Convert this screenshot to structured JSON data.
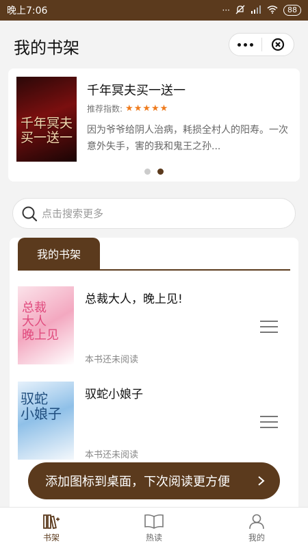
{
  "status_bar": {
    "time": "晚上7:06",
    "battery": "88"
  },
  "header": {
    "title": "我的书架"
  },
  "banner": {
    "title": "千年冥夫买一送一",
    "rating_label": "推荐指数:",
    "stars": "★★★★★",
    "description": "因为爷爷给阴人治病，耗损全村人的阳寿。一次意外失手，害的我和鬼王之孙...",
    "cover_text": "千年冥夫\n买一送一"
  },
  "search": {
    "placeholder": "点击搜索更多"
  },
  "shelf": {
    "tab_label": "我的书架",
    "books": [
      {
        "title": "总裁大人，晚上见!",
        "status": "本书还未阅读",
        "cover_text": "总裁\n大人\n晚上见"
      },
      {
        "title": "驭蛇小娘子",
        "status": "本书还未阅读",
        "cover_text": "驭蛇\n小娘子"
      }
    ]
  },
  "toast": {
    "text": "添加图标到桌面，下次阅读更方便"
  },
  "tabbar": {
    "items": [
      {
        "label": "书架"
      },
      {
        "label": "热读"
      },
      {
        "label": "我的"
      }
    ]
  },
  "colors": {
    "accent": "#5b3a1d",
    "star": "#ef7b1d"
  }
}
